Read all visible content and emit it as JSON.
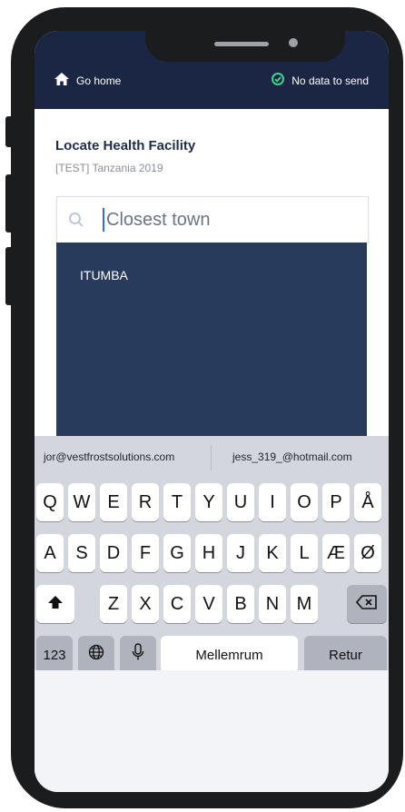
{
  "header": {
    "home_label": "Go home",
    "status_label": "No data to send",
    "home_icon": "home-icon",
    "status_icon": "check-circle-icon"
  },
  "page": {
    "title": "Locate Health Facility",
    "subtitle": "[TEST] Tanzania 2019"
  },
  "search": {
    "placeholder": "Closest town",
    "value": ""
  },
  "dropdown": {
    "options": [
      "ITUMBA"
    ]
  },
  "keyboard": {
    "suggestions": [
      "jor@vestfrostsolutions.com",
      "jess_319_@hotmail.com"
    ],
    "row1": [
      "Q",
      "W",
      "E",
      "R",
      "T",
      "Y",
      "U",
      "I",
      "O",
      "P",
      "Å"
    ],
    "row2": [
      "A",
      "S",
      "D",
      "F",
      "G",
      "H",
      "J",
      "K",
      "L",
      "Æ",
      "Ø"
    ],
    "row3": [
      "Z",
      "X",
      "C",
      "V",
      "B",
      "N",
      "M"
    ],
    "numbers_key": "123",
    "space_key": "Mellemrum",
    "return_key": "Retur"
  }
}
